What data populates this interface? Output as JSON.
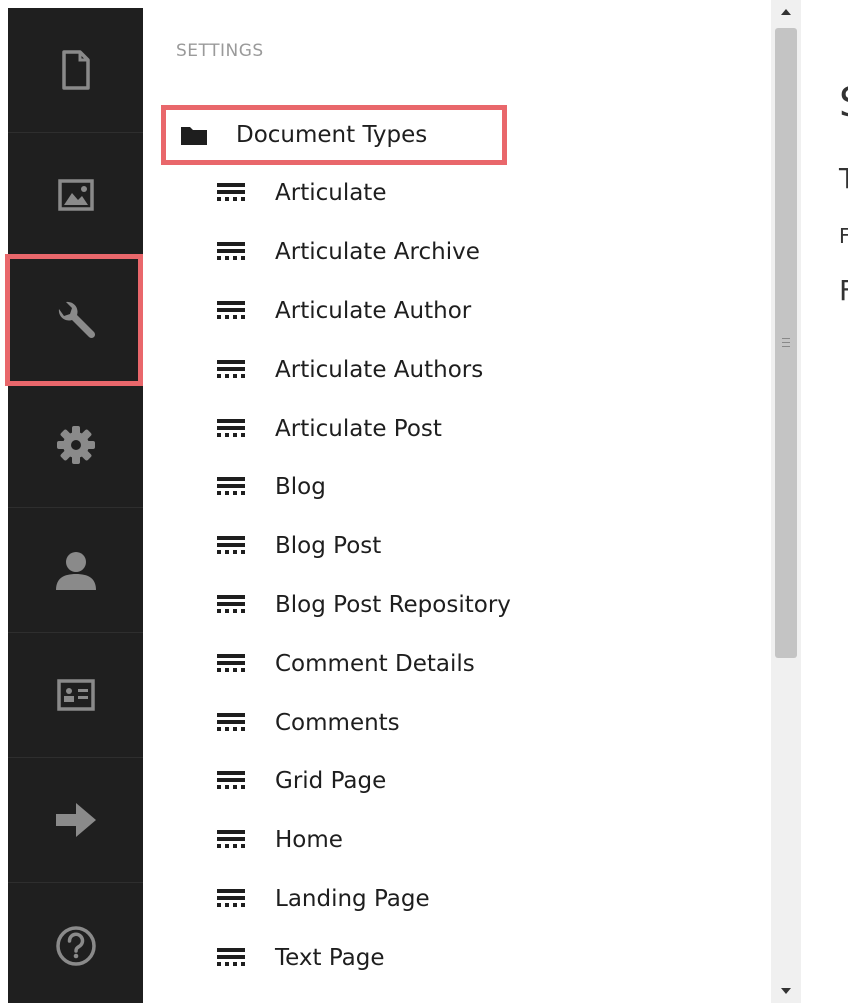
{
  "rail": {
    "items": [
      {
        "name": "content",
        "icon": "document-icon"
      },
      {
        "name": "media",
        "icon": "image-icon"
      },
      {
        "name": "settings",
        "icon": "wrench-icon",
        "highlighted": true
      },
      {
        "name": "developer",
        "icon": "gear-icon"
      },
      {
        "name": "users",
        "icon": "user-icon"
      },
      {
        "name": "members",
        "icon": "id-card-icon"
      },
      {
        "name": "forms",
        "icon": "arrow-right-icon"
      },
      {
        "name": "help",
        "icon": "question-circle-icon"
      }
    ]
  },
  "tree": {
    "section_title": "SETTINGS",
    "root": {
      "label": "Document Types",
      "icon": "folder-icon"
    },
    "items": [
      {
        "label": "Articulate"
      },
      {
        "label": "Articulate Archive"
      },
      {
        "label": "Articulate Author"
      },
      {
        "label": "Articulate Authors"
      },
      {
        "label": "Articulate Post"
      },
      {
        "label": "Blog"
      },
      {
        "label": "Blog Post"
      },
      {
        "label": "Blog Post Repository"
      },
      {
        "label": "Comment Details"
      },
      {
        "label": "Comments"
      },
      {
        "label": "Grid Page"
      },
      {
        "label": "Home"
      },
      {
        "label": "Landing Page"
      },
      {
        "label": "Text Page"
      }
    ]
  },
  "content": {
    "heading": "S",
    "line1": "T",
    "line2": "F",
    "line3": "F"
  },
  "colors": {
    "rail_bg": "#1f1f1f",
    "rail_icon": "#8a8a8a",
    "highlight": "#e9676b",
    "text": "#1e1e1e",
    "muted": "#9a9a9a"
  }
}
